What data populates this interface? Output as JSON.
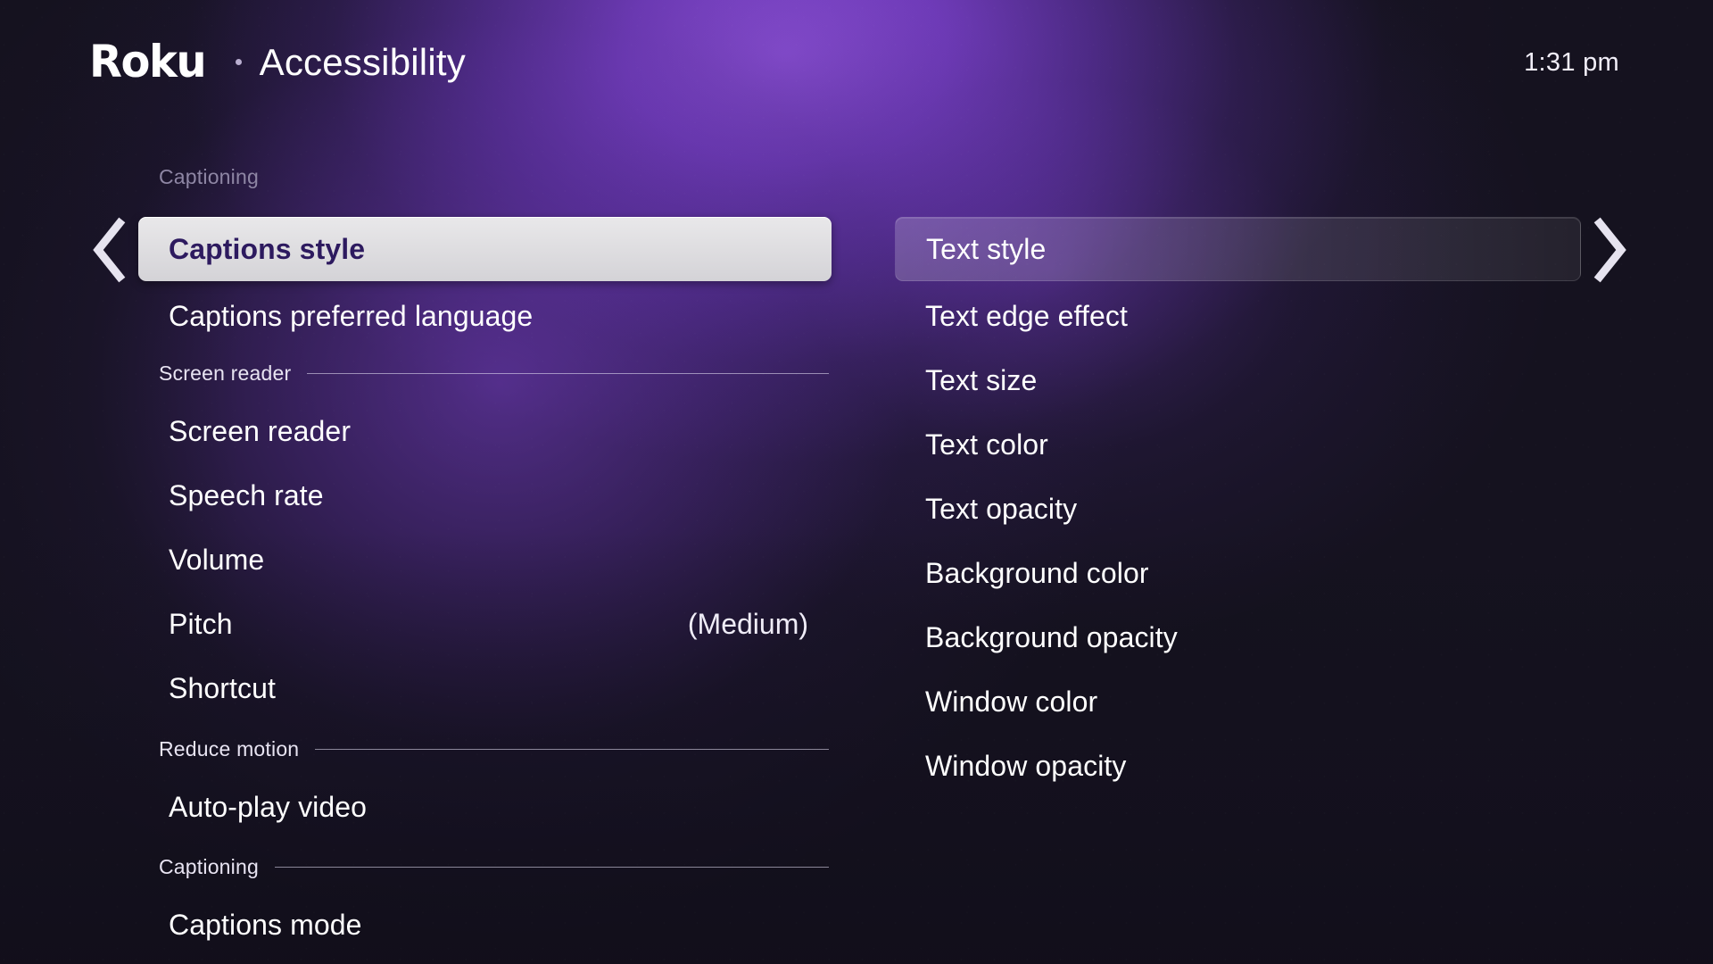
{
  "header": {
    "brand": "Roku",
    "separator_icon": "bullet-dot-icon",
    "title": "Accessibility",
    "clock": "1:31 pm"
  },
  "nav": {
    "left_arrow_icon": "chevron-left-icon",
    "right_arrow_icon": "chevron-right-icon"
  },
  "colors": {
    "background_dark": "#15121f",
    "glow_purple": "#7b3fd4",
    "selected_plate": "#dedde0",
    "selected_text": "#2d1a5f",
    "text_primary": "#ffffff",
    "caption_muted": "#8e86a4",
    "rule": "#e2dcf2"
  },
  "left_column": {
    "caption": "Captioning",
    "items": [
      {
        "label": "Captions style",
        "value": "",
        "selected": true
      },
      {
        "label": "Captions preferred language",
        "value": "",
        "selected": false
      }
    ],
    "sections": [
      {
        "header": "Screen reader",
        "items": [
          {
            "label": "Screen reader",
            "value": "",
            "selected": false
          },
          {
            "label": "Speech rate",
            "value": "",
            "selected": false
          },
          {
            "label": "Volume",
            "value": "",
            "selected": false
          },
          {
            "label": "Pitch",
            "value": "(Medium)",
            "selected": false
          },
          {
            "label": "Shortcut",
            "value": "",
            "selected": false
          }
        ]
      },
      {
        "header": "Reduce motion",
        "items": [
          {
            "label": "Auto-play video",
            "value": "",
            "selected": false
          }
        ]
      },
      {
        "header": "Captioning",
        "items": [
          {
            "label": "Captions mode",
            "value": "",
            "selected": false
          }
        ]
      }
    ]
  },
  "right_column": {
    "items": [
      {
        "label": "Text style",
        "selected": true
      },
      {
        "label": "Text edge effect",
        "selected": false
      },
      {
        "label": "Text size",
        "selected": false
      },
      {
        "label": "Text color",
        "selected": false
      },
      {
        "label": "Text opacity",
        "selected": false
      },
      {
        "label": "Background color",
        "selected": false
      },
      {
        "label": "Background opacity",
        "selected": false
      },
      {
        "label": "Window color",
        "selected": false
      },
      {
        "label": "Window opacity",
        "selected": false
      }
    ]
  }
}
